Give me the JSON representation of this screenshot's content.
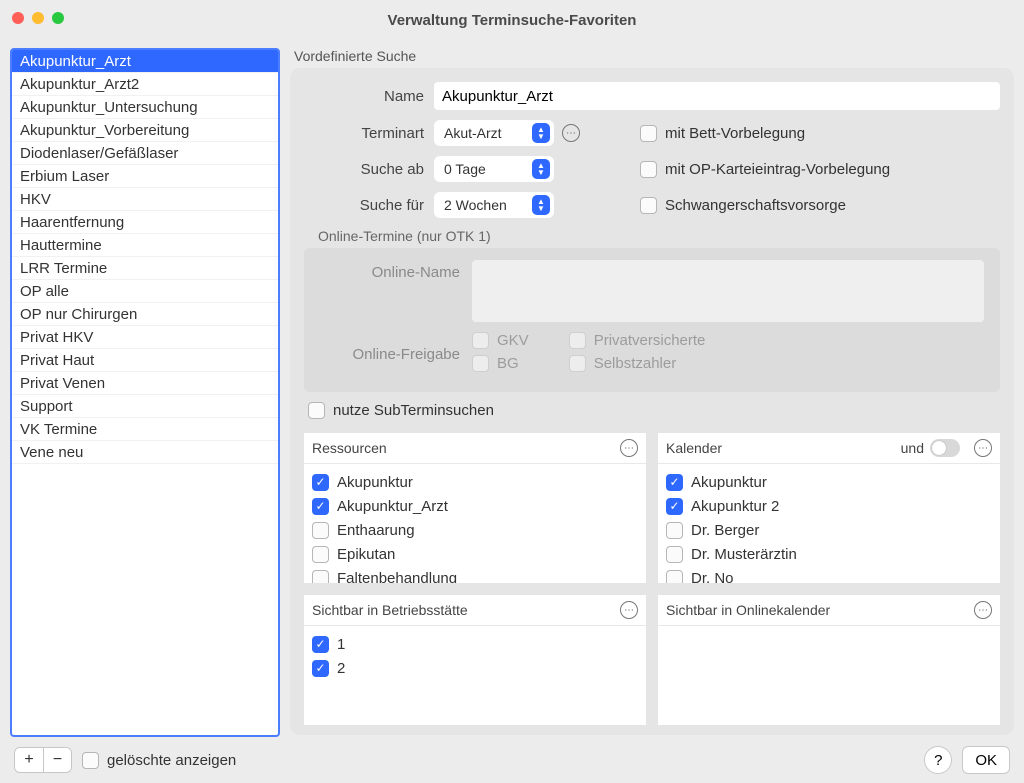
{
  "window": {
    "title": "Verwaltung Terminsuche-Favoriten"
  },
  "favorites": {
    "selected_index": 0,
    "items": [
      "Akupunktur_Arzt",
      "Akupunktur_Arzt2",
      "Akupunktur_Untersuchung",
      "Akupunktur_Vorbereitung",
      "Diodenlaser/Gefäßlaser",
      "Erbium Laser",
      "HKV",
      "Haarentfernung",
      "Hauttermine",
      "LRR Termine",
      "OP alle",
      "OP nur Chirurgen",
      "Privat HKV",
      "Privat Haut",
      "Privat Venen",
      "Support",
      "VK Termine",
      "Vene neu"
    ]
  },
  "predef": {
    "section_label": "Vordefinierte Suche",
    "name_label": "Name",
    "name_value": "Akupunktur_Arzt",
    "terminart_label": "Terminart",
    "terminart_value": "Akut-Arzt",
    "sucheab_label": "Suche ab",
    "sucheab_value": "0 Tage",
    "suchefuer_label": "Suche für",
    "suchefuer_value": "2 Wochen",
    "opt_bett": "mit Bett-Vorbelegung",
    "opt_op": "mit OP-Karteieintrag-Vorbelegung",
    "opt_schwanger": "Schwangerschaftsvorsorge"
  },
  "online": {
    "section_label": "Online-Termine (nur OTK 1)",
    "online_name_label": "Online-Name",
    "freigabe_label": "Online-Freigabe",
    "gkv": "GKV",
    "bg": "BG",
    "privat": "Privatversicherte",
    "selbst": "Selbstzahler"
  },
  "sub_use_label": "nutze SubTerminsuchen",
  "resources": {
    "header": "Ressourcen",
    "items": [
      {
        "label": "Akupunktur",
        "checked": true
      },
      {
        "label": "Akupunktur_Arzt",
        "checked": true
      },
      {
        "label": "Enthaarung",
        "checked": false
      },
      {
        "label": "Epikutan",
        "checked": false
      },
      {
        "label": "Faltenbehandlung",
        "checked": false
      }
    ]
  },
  "calendars": {
    "header": "Kalender",
    "and_label": "und",
    "items": [
      {
        "label": "Akupunktur",
        "checked": true
      },
      {
        "label": "Akupunktur 2",
        "checked": true
      },
      {
        "label": "Dr. Berger",
        "checked": false
      },
      {
        "label": "Dr. Musterärztin",
        "checked": false
      },
      {
        "label": "Dr. No",
        "checked": false
      }
    ]
  },
  "visible_bs": {
    "header": "Sichtbar in Betriebsstätte",
    "items": [
      {
        "label": "1",
        "checked": true
      },
      {
        "label": "2",
        "checked": true
      }
    ]
  },
  "visible_online": {
    "header": "Sichtbar in Onlinekalender",
    "items": []
  },
  "footer": {
    "show_deleted": "gelöschte anzeigen",
    "ok": "OK",
    "help": "?",
    "plus": "+",
    "minus": "−"
  }
}
